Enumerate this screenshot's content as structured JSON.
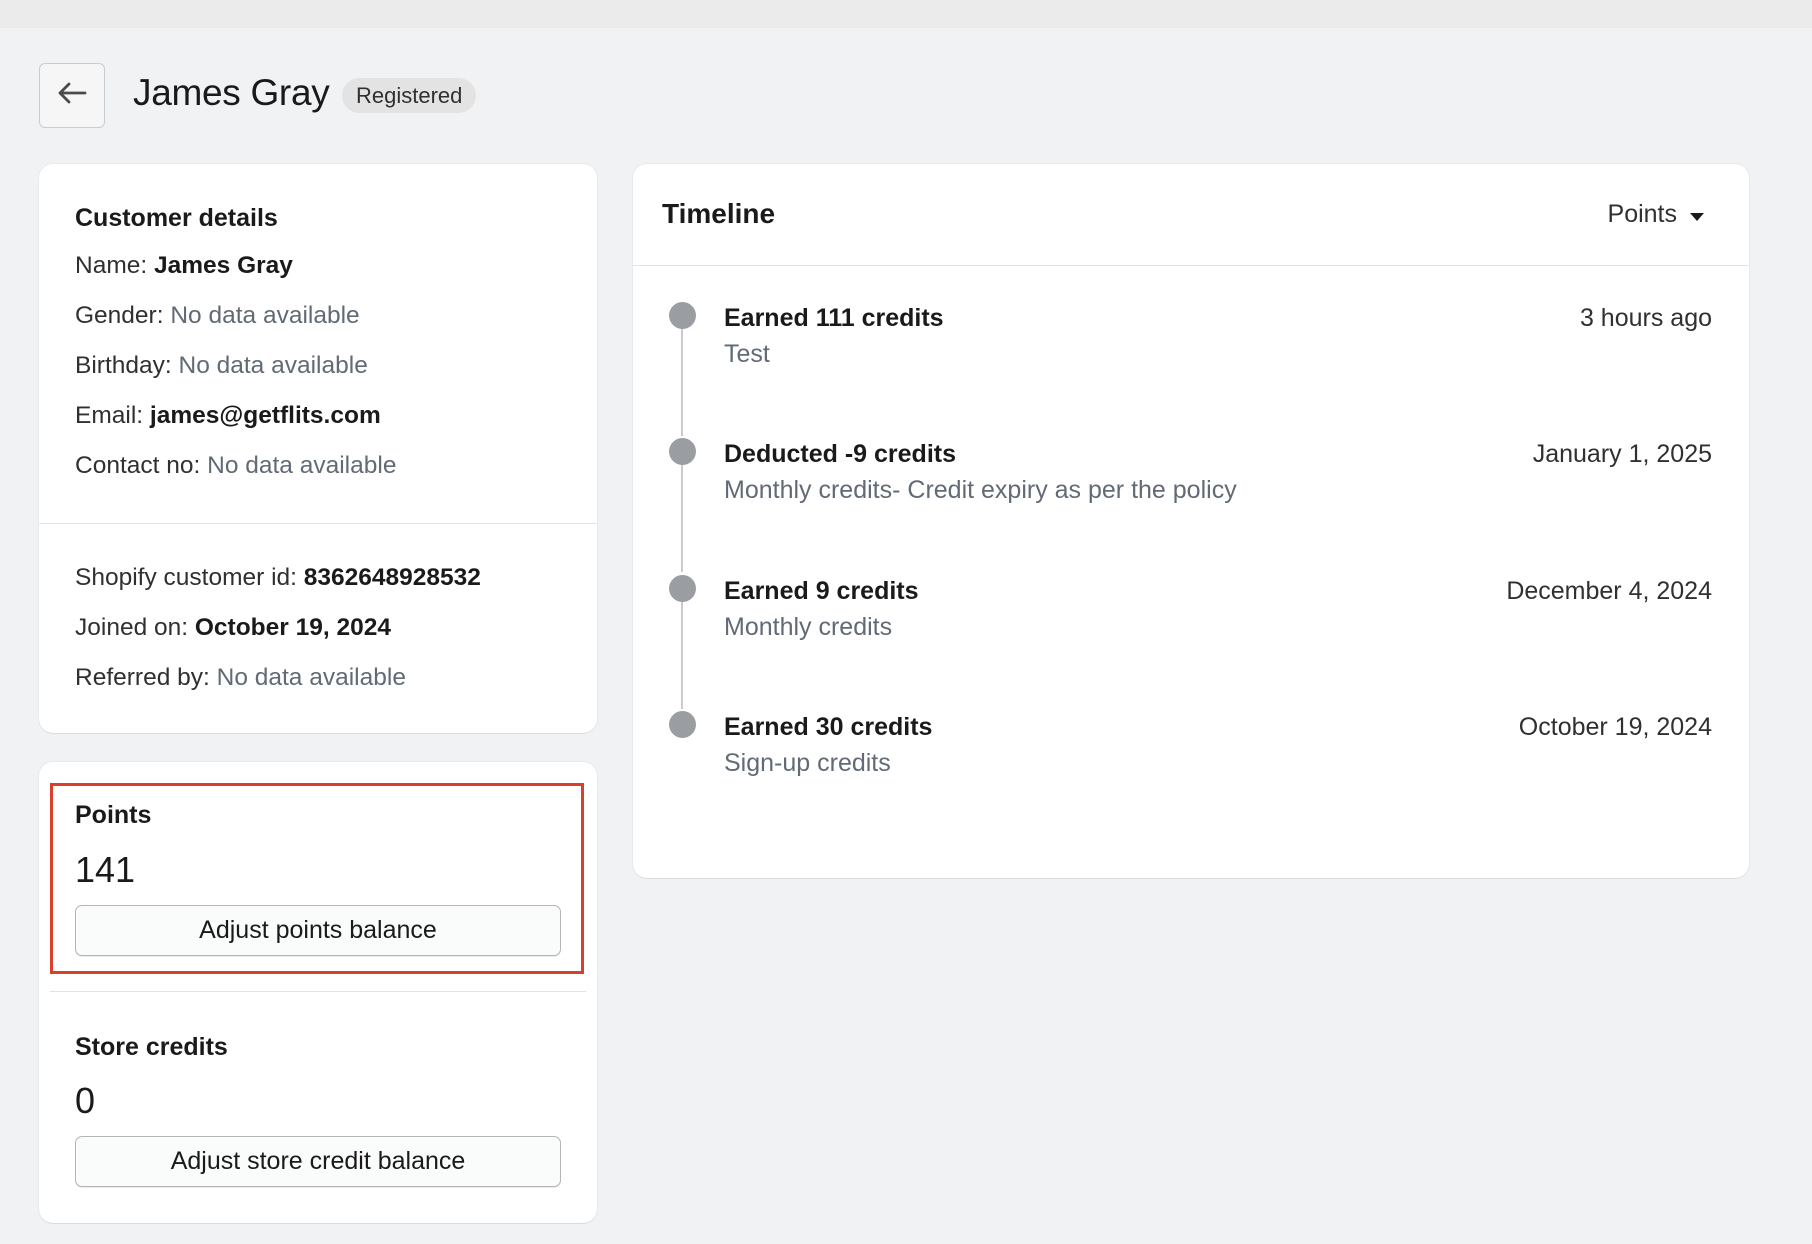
{
  "header": {
    "title": "James Gray",
    "status_badge": "Registered"
  },
  "customer_details": {
    "title": "Customer details",
    "fields": [
      {
        "label": "Name:",
        "value": "James Gray",
        "style": "strong"
      },
      {
        "label": "Gender:",
        "value": "No data available",
        "style": "muted"
      },
      {
        "label": "Birthday:",
        "value": "No data available",
        "style": "muted"
      },
      {
        "label": "Email:",
        "value": "james@getflits.com",
        "style": "strong"
      },
      {
        "label": "Contact no:",
        "value": "No data available",
        "style": "muted"
      }
    ],
    "meta": [
      {
        "label": "Shopify customer id:",
        "value": "8362648928532",
        "style": "strong"
      },
      {
        "label": "Joined on:",
        "value": "October 19, 2024",
        "style": "strong"
      },
      {
        "label": "Referred by:",
        "value": "No data available",
        "style": "muted"
      }
    ]
  },
  "points": {
    "title": "Points",
    "value": "141",
    "button_label": "Adjust points balance"
  },
  "store_credits": {
    "title": "Store credits",
    "value": "0",
    "button_label": "Adjust store credit balance"
  },
  "timeline": {
    "title": "Timeline",
    "filter_label": "Points",
    "events": [
      {
        "title": "Earned 111 credits",
        "description": "Test",
        "time": "3 hours ago"
      },
      {
        "title": "Deducted -9 credits",
        "description": "Monthly credits- Credit expiry as per the policy",
        "time": "January 1, 2025"
      },
      {
        "title": "Earned 9 credits",
        "description": "Monthly credits",
        "time": "December 4, 2024"
      },
      {
        "title": "Earned 30 credits",
        "description": "Sign-up credits",
        "time": "October 19, 2024"
      }
    ]
  },
  "colors": {
    "highlight": "#d9402b",
    "background": "#f1f2f4",
    "timeline_dot": "#9a9ea3"
  }
}
